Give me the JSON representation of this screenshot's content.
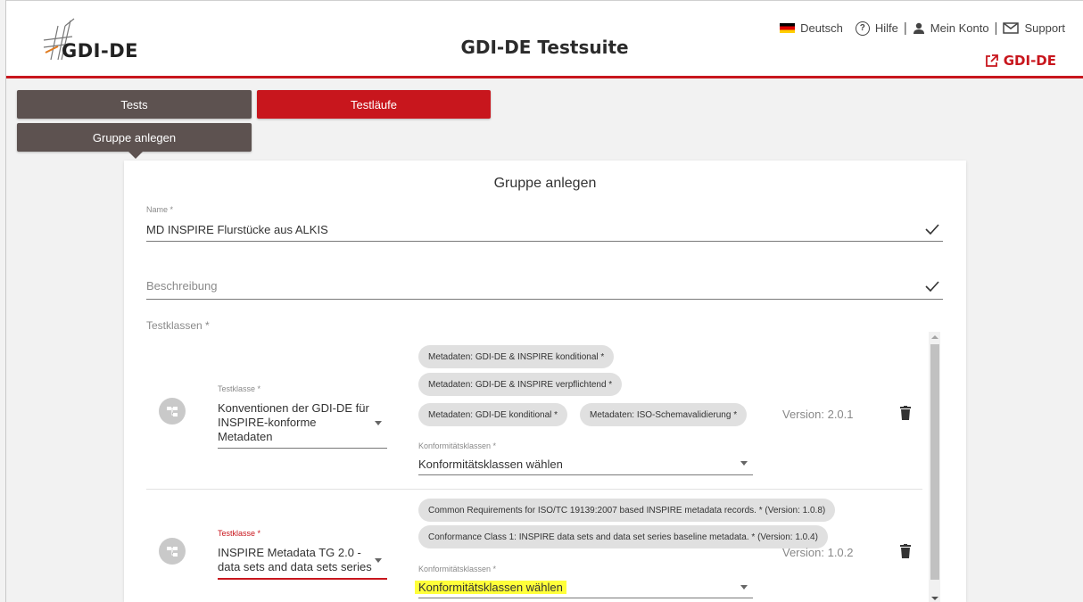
{
  "header": {
    "logo_text": "GDI-DE",
    "title": "GDI-DE Testsuite",
    "nav": {
      "language": "Deutsch",
      "help": "Hilfe",
      "account": "Mein Konto",
      "support": "Support",
      "separator": "|"
    },
    "external_link": "GDI-DE"
  },
  "tabs": {
    "tests": "Tests",
    "testlaeufe": "Testläufe",
    "gruppe_anlegen": "Gruppe anlegen"
  },
  "form": {
    "title": "Gruppe anlegen",
    "name_label": "Name *",
    "name_value": "MD INSPIRE Flurstücke aus ALKIS",
    "description_placeholder": "Beschreibung",
    "testklassen_label": "Testklassen *",
    "rows": [
      {
        "testklasse_label": "Testklasse *",
        "testklasse_lines": [
          "Konventionen der GDI-DE für",
          "INSPIRE-konforme",
          "Metadaten"
        ],
        "chips": [
          "Metadaten: GDI-DE & INSPIRE konditional *",
          "Metadaten: GDI-DE & INSPIRE verpflichtend *",
          "Metadaten: GDI-DE konditional *",
          "Metadaten: ISO-Schemavalidierung *"
        ],
        "konformitaet_label": "Konformitätsklassen *",
        "konformitaet_value": "Konformitätsklassen wählen",
        "version": "Version: 2.0.1"
      },
      {
        "testklasse_label": "Testklasse *",
        "testklasse_lines": [
          "INSPIRE Metadata TG 2.0 -",
          "data sets and data sets series"
        ],
        "chips": [
          "Common Requirements for ISO/TC 19139:2007 based INSPIRE metadata records. * (Version: 1.0.8)",
          "Conformance Class 1: INSPIRE data sets and data set series baseline metadata. * (Version: 1.0.4)"
        ],
        "konformitaet_label": "Konformitätsklassen *",
        "konformitaet_value": "Konformitätsklassen wählen",
        "version": "Version: 1.0.2"
      }
    ]
  },
  "colors": {
    "brand_red": "#c8161d",
    "tab_dark": "#5d5250",
    "highlight": "#ffff3a"
  }
}
